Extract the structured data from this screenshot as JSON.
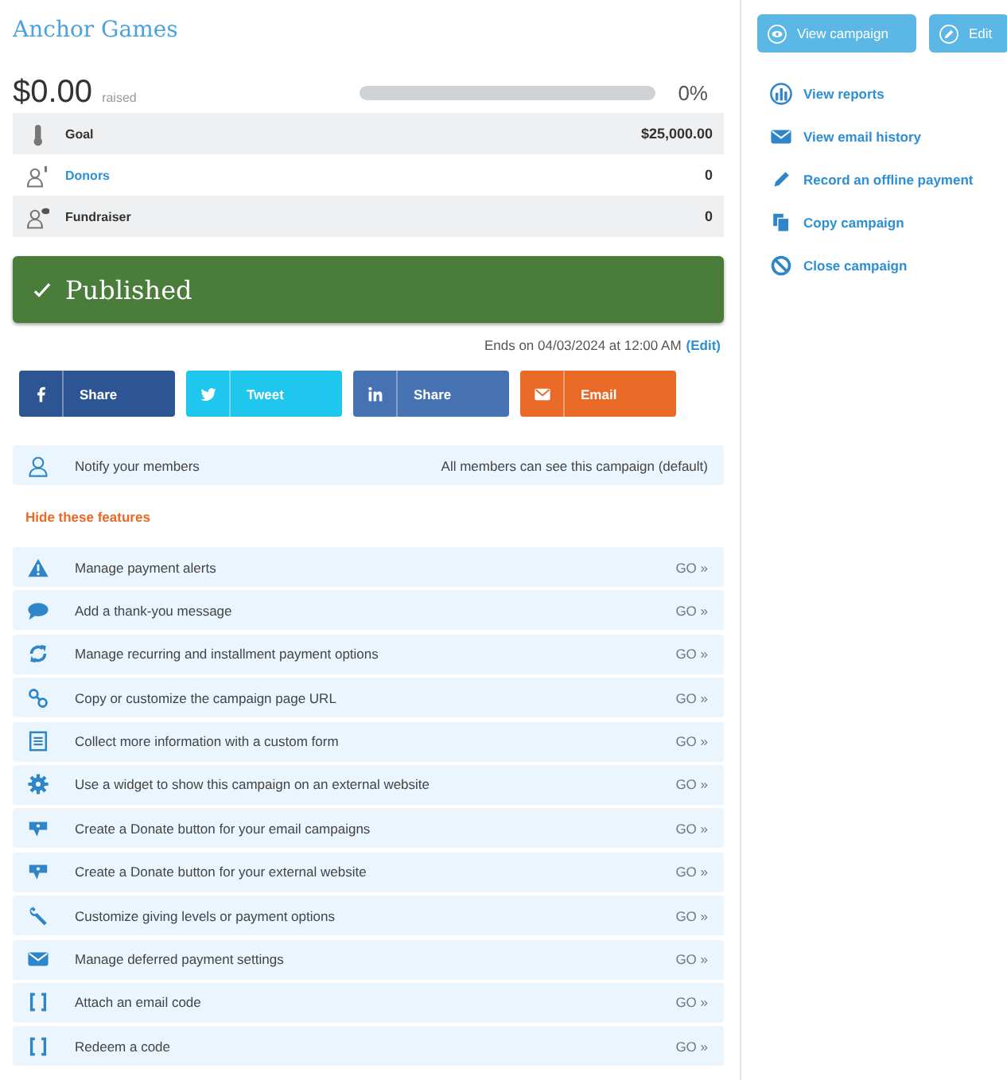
{
  "campaign": {
    "title": "Anchor Games",
    "raised": "$0.00",
    "raised_label": "raised",
    "progress": {
      "level": 0,
      "reading": "0%"
    }
  },
  "stats": [
    {
      "kind": "thermometer",
      "label": "Goal",
      "link": false,
      "value": "$25,000.00"
    },
    {
      "kind": "donor",
      "label": "Donors",
      "link": true,
      "value": "0"
    },
    {
      "kind": "fundraiser",
      "label": "Fundraiser",
      "link": false,
      "value": "0"
    }
  ],
  "status": {
    "label": "Published"
  },
  "end_date": {
    "text": "Ends on 04/03/2024 at 12:00 AM",
    "edit_link": "(Edit)"
  },
  "share_buttons": [
    {
      "kind": "facebook",
      "label": "Share",
      "color": "#2d5593"
    },
    {
      "kind": "twitter",
      "label": "Tweet",
      "color": "#1fc6ee"
    },
    {
      "kind": "linkedin",
      "label": "Share",
      "color": "#4672b4"
    },
    {
      "kind": "email",
      "label": "Email",
      "color": "#e96a27"
    }
  ],
  "notify": {
    "label": "Notify your members",
    "visibility": "All members can see this campaign (default)"
  },
  "hide_features_link": "Hide these features",
  "features": [
    {
      "kind": "alert",
      "label": "Manage payment alerts",
      "action": "GO »"
    },
    {
      "kind": "chat",
      "label": "Add a thank-you message",
      "action": "GO »"
    },
    {
      "kind": "sync",
      "label": "Manage recurring and installment payment options",
      "action": "GO »"
    },
    {
      "kind": "link",
      "label": "Copy or customize the campaign page URL",
      "action": "GO »"
    },
    {
      "kind": "form",
      "label": "Collect more information with a custom form",
      "action": "GO »"
    },
    {
      "kind": "gear",
      "label": "Use a widget to show this campaign on an external website",
      "action": "GO »"
    },
    {
      "kind": "donate",
      "label": "Create a Donate button for your email campaigns",
      "action": "GO »"
    },
    {
      "kind": "donate",
      "label": "Create a Donate button for your external website",
      "action": "GO »"
    },
    {
      "kind": "wrench",
      "label": "Customize giving levels or payment options",
      "action": "GO »"
    },
    {
      "kind": "envelope",
      "label": "Manage deferred payment settings",
      "action": "GO »"
    },
    {
      "kind": "brackets",
      "label": "Attach an email code",
      "action": "GO »"
    },
    {
      "kind": "brackets",
      "label": "Redeem a code",
      "action": "GO »"
    }
  ],
  "header_buttons": [
    {
      "kind": "eye",
      "label": "View campaign"
    },
    {
      "kind": "pencil",
      "label": "Edit"
    }
  ],
  "actions": [
    {
      "kind": "chart",
      "label": "View reports"
    },
    {
      "kind": "envelope",
      "label": "View email history"
    },
    {
      "kind": "pencil",
      "label": "Record an offline payment"
    },
    {
      "kind": "copy",
      "label": "Copy campaign"
    },
    {
      "kind": "ban",
      "label": "Close campaign"
    }
  ]
}
